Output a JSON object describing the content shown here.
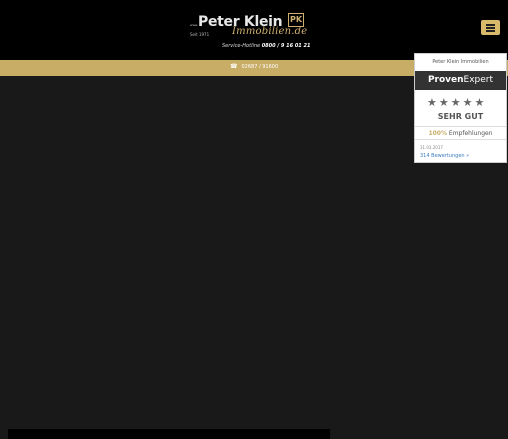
{
  "header": {
    "logo": {
      "www": "www.",
      "name": "Peter Klein",
      "script": "Immobilien.de",
      "since": "Seit 1971",
      "monogram": "PK",
      "hotline_label": "Service-Hotline",
      "hotline_number": "0800 / 9 16 01 21"
    }
  },
  "phone_bar": {
    "icon": "phone-icon",
    "number": "02687 / 91600"
  },
  "widget": {
    "company": "Peter Klein Immobilien",
    "brand_bold": "Proven",
    "brand_light": "Expert",
    "stars": "★★★★★",
    "rating_value": 4.5,
    "rating_max": 5,
    "grade": "SEHR GUT",
    "recommend_pct": "100%",
    "recommend_label": "Empfehlungen",
    "date": "31.03.2017",
    "reviews_link": "314 Bewertungen »"
  },
  "colors": {
    "accent": "#c8ad66",
    "background": "#191919",
    "header": "#000000"
  }
}
